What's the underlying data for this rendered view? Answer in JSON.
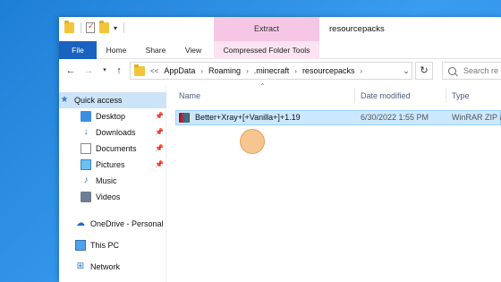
{
  "window": {
    "title": "resourcepacks",
    "context_group": "Extract"
  },
  "ribbon": {
    "tabs": [
      "File",
      "Home",
      "Share",
      "View",
      "Compressed Folder Tools"
    ]
  },
  "address": {
    "overflow": "<<",
    "breadcrumbs": [
      "AppData",
      "Roaming",
      ".minecraft",
      "resourcepacks"
    ]
  },
  "search": {
    "placeholder": "Search re"
  },
  "navpane": {
    "items": [
      {
        "label": "Quick access",
        "icon": "star-icon"
      },
      {
        "label": "Desktop",
        "icon": "desktop-icon"
      },
      {
        "label": "Downloads",
        "icon": "downloads-icon"
      },
      {
        "label": "Documents",
        "icon": "documents-icon"
      },
      {
        "label": "Pictures",
        "icon": "pictures-icon"
      },
      {
        "label": "Music",
        "icon": "music-icon"
      },
      {
        "label": "Videos",
        "icon": "videos-icon"
      },
      {
        "label": "OneDrive - Personal",
        "icon": "onedrive-icon"
      },
      {
        "label": "This PC",
        "icon": "this-pc-icon"
      },
      {
        "label": "Network",
        "icon": "network-icon"
      }
    ]
  },
  "filelist": {
    "columns": [
      "Name",
      "Date modified",
      "Type"
    ],
    "rows": [
      {
        "name": "Better+Xray+[+Vanilla+]+1.19",
        "date": "6/30/2022 1:55 PM",
        "type": "WinRAR ZIP ar"
      }
    ]
  },
  "colors": {
    "file_tab": "#1a62bf",
    "context_tab": "#f6c7e4",
    "selection": "#cce8ff",
    "desktop_bg": "#2b8be6"
  }
}
